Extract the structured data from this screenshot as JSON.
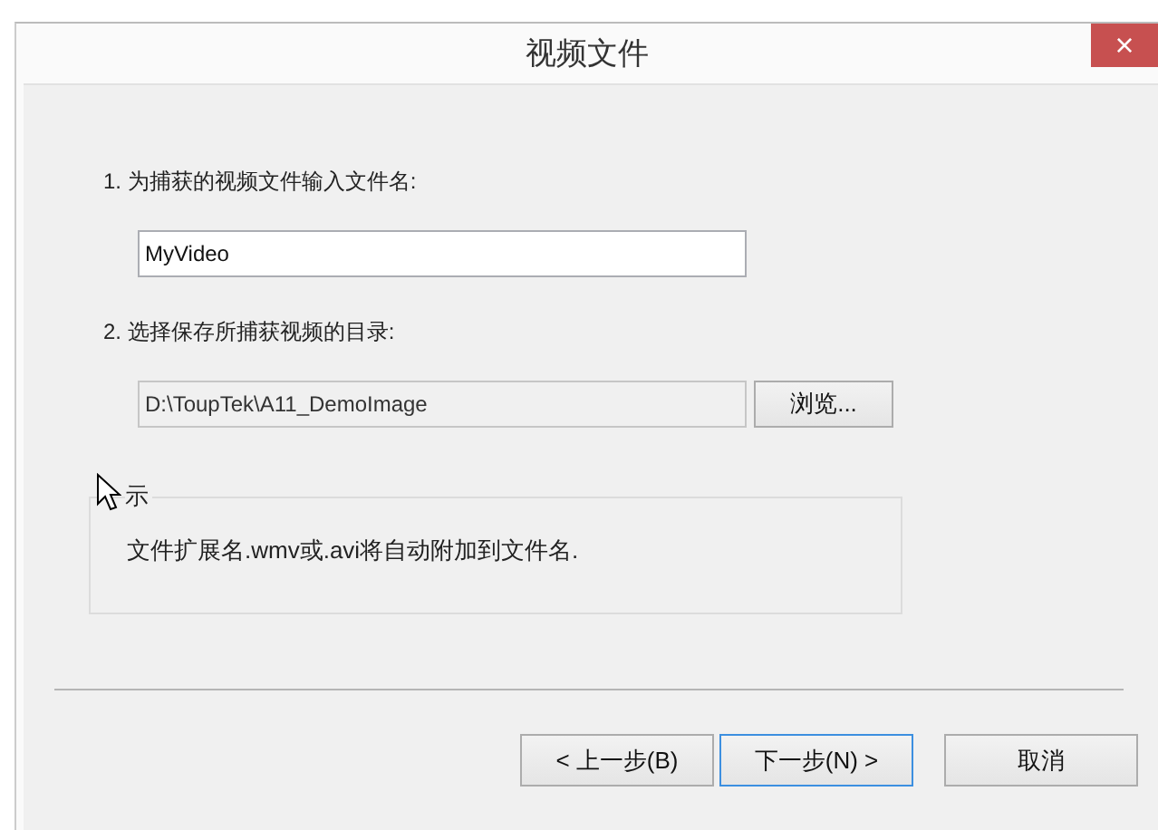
{
  "window": {
    "title": "视频文件",
    "close": "×"
  },
  "steps": [
    {
      "label": "1. 为捕获的视频文件输入文件名:",
      "field": {
        "value": "MyVideo",
        "disabled": false
      }
    },
    {
      "label": "2. 选择保存所捕获视频的目录:",
      "field": {
        "value": "D:\\ToupTek\\A11_DemoImage",
        "disabled": true
      },
      "button": "浏览..."
    }
  ],
  "hint": {
    "label": "示",
    "text": "文件扩展名.wmv或.avi将自动附加到文件名."
  },
  "buttons": [
    {
      "label": "< 上一步(B)",
      "default": false
    },
    {
      "label": "下一步(N) >",
      "default": true
    },
    {
      "label": "取消",
      "default": false
    }
  ]
}
